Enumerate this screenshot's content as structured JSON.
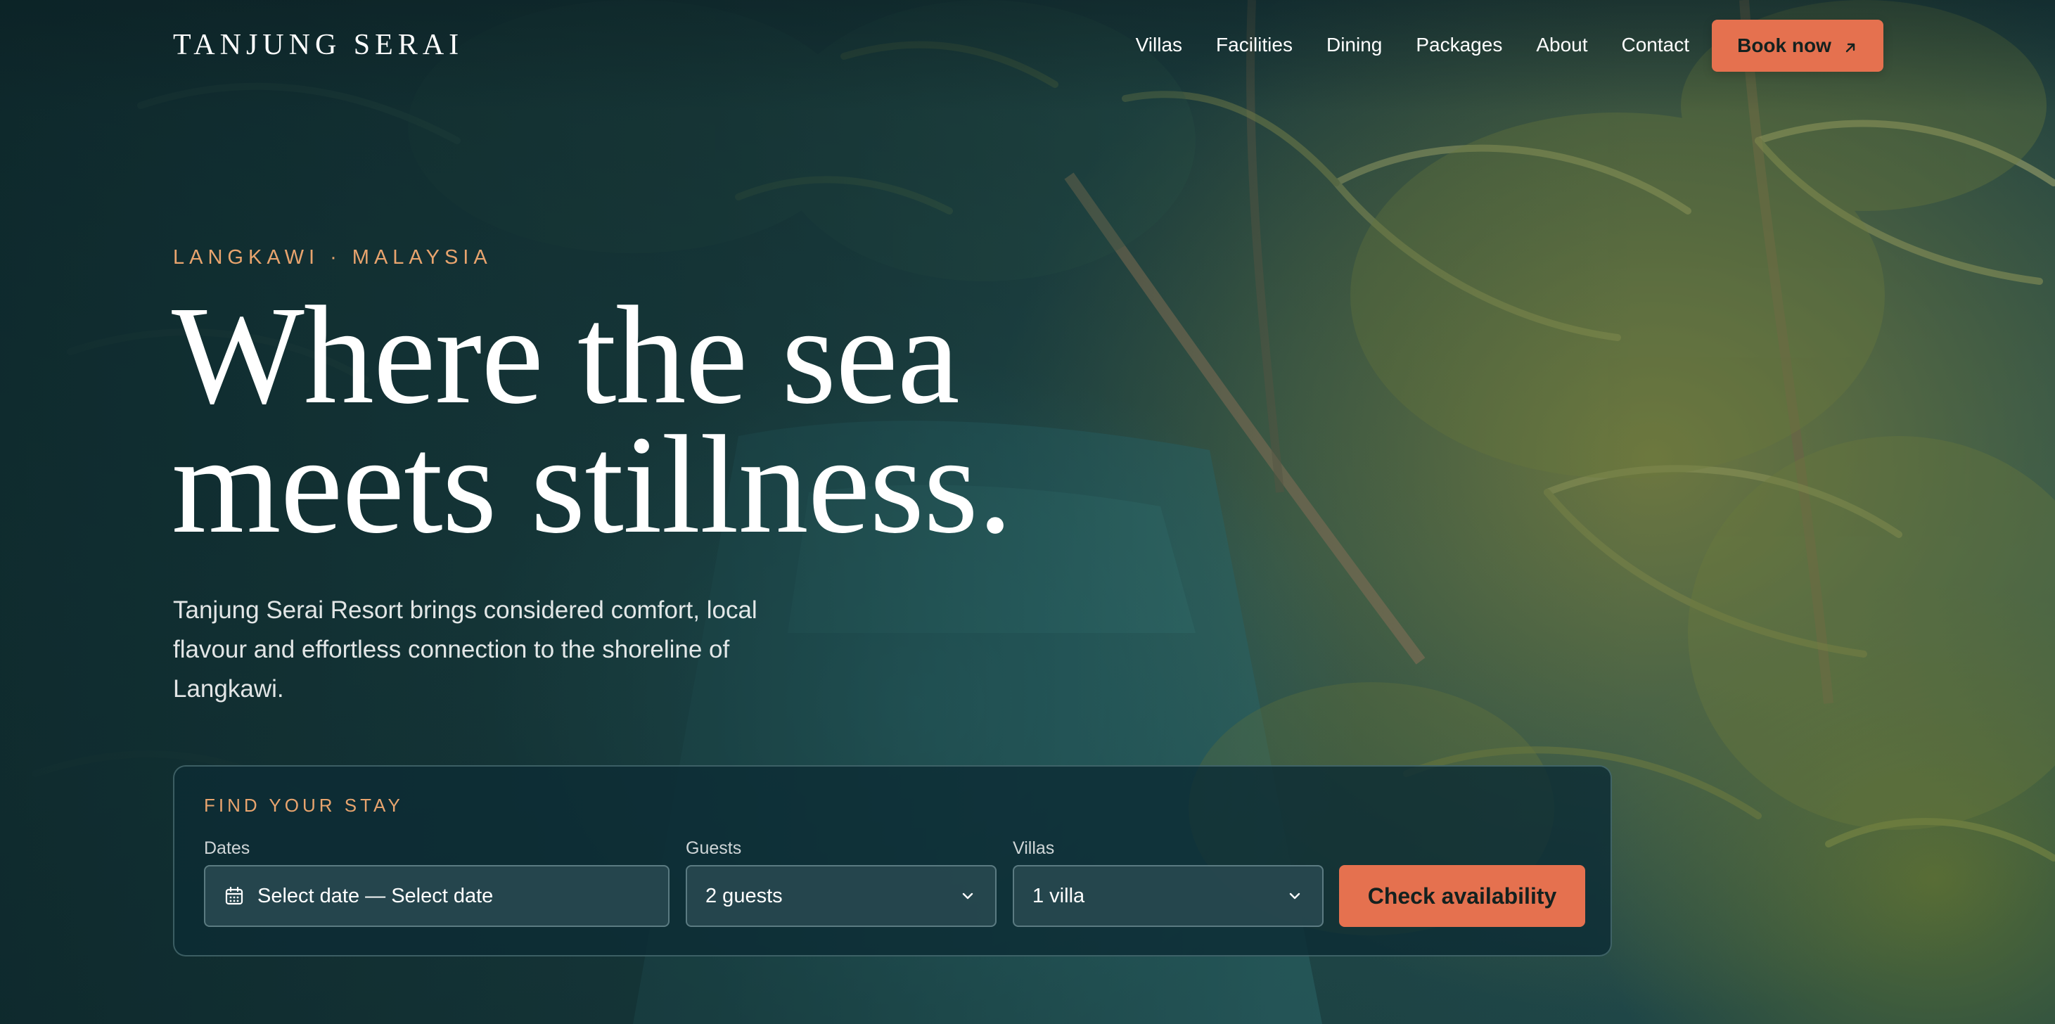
{
  "brand": {
    "name": "TANJUNG SERAI"
  },
  "nav": {
    "items": [
      {
        "label": "Villas"
      },
      {
        "label": "Facilities"
      },
      {
        "label": "Dining"
      },
      {
        "label": "Packages"
      },
      {
        "label": "About"
      },
      {
        "label": "Contact"
      }
    ],
    "cta_label": "Book now",
    "cta_icon": "arrow-up-right-icon"
  },
  "hero": {
    "eyebrow": "LANGKAWI · MALAYSIA",
    "headline_line1": "Where the sea",
    "headline_line2": "meets stillness.",
    "description": "Tanjung Serai Resort brings considered comfort, local flavour and effortless connection to the shoreline of Langkawi."
  },
  "booking": {
    "title": "FIND YOUR STAY",
    "dates": {
      "label": "Dates",
      "value": "Select date — Select date",
      "icon": "calendar-icon"
    },
    "guests": {
      "label": "Guests",
      "value": "2 guests",
      "icon": "chevron-down-icon"
    },
    "villas": {
      "label": "Villas",
      "value": "1 villa",
      "icon": "chevron-down-icon"
    },
    "submit_label": "Check availability"
  },
  "colors": {
    "accent": "#e5714f",
    "eyebrow": "#e8a46e",
    "panel": "#0c2c34"
  }
}
